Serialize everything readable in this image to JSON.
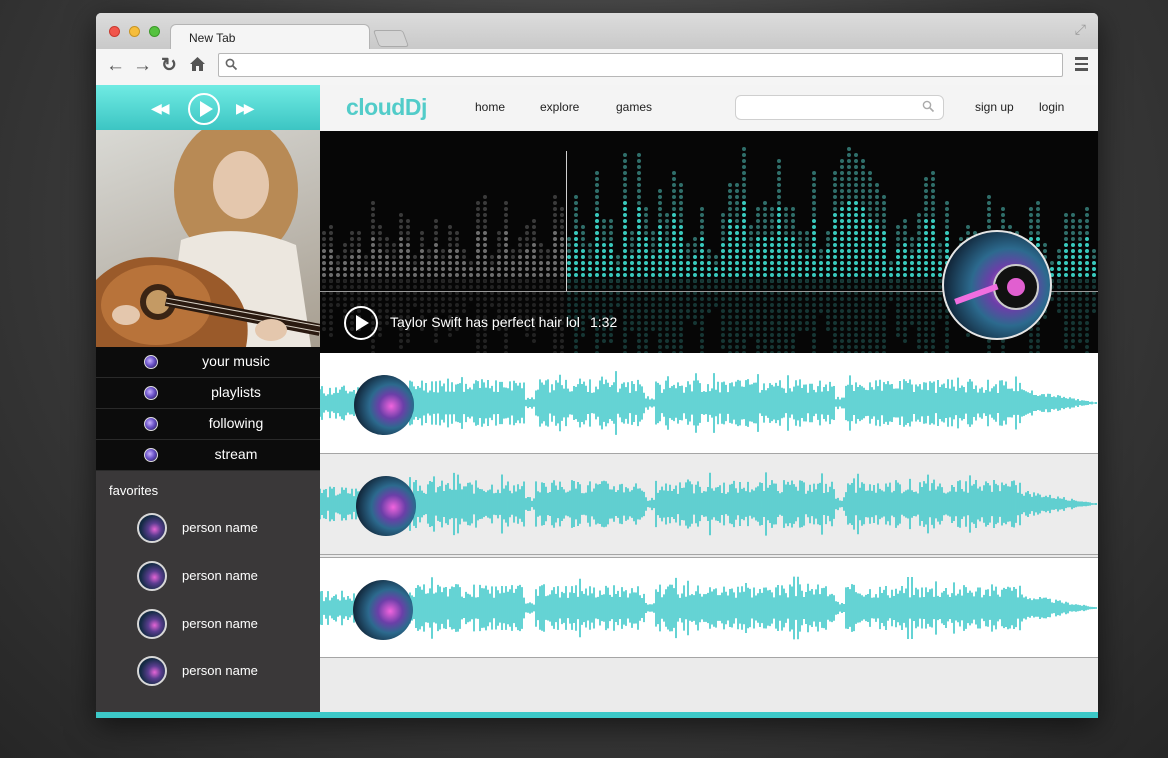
{
  "browser": {
    "tab_title": "New Tab",
    "address_value": ""
  },
  "player": {
    "rewind_icon": "rewind-icon",
    "play_icon": "play-icon",
    "forward_icon": "fast-forward-icon",
    "accent_color": "#3cc9c8"
  },
  "sidebar": {
    "menu": [
      {
        "label": "your music"
      },
      {
        "label": "playlists"
      },
      {
        "label": "following"
      },
      {
        "label": "stream"
      }
    ],
    "favorites_title": "favorites",
    "favorites": [
      {
        "name": "person name"
      },
      {
        "name": "person name"
      },
      {
        "name": "person name"
      },
      {
        "name": "person name"
      }
    ]
  },
  "header": {
    "logo": "cloudDj",
    "nav": [
      "home",
      "explore",
      "games"
    ],
    "search_placeholder": "",
    "sign_up": "sign up",
    "login": "login",
    "brand_color": "#52ccc9"
  },
  "hero": {
    "title": "Taylor Swift has perfect hair lol",
    "time": "1:32"
  },
  "tracks": [
    {
      "id": "track-1"
    },
    {
      "id": "track-2"
    },
    {
      "id": "track-3"
    }
  ]
}
